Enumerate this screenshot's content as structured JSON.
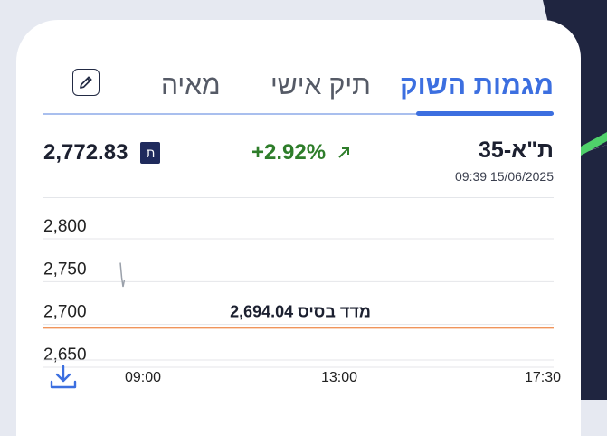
{
  "tabs": {
    "market": "מגמות השוק",
    "personal": "תיק אישי",
    "maya": "מאיה"
  },
  "index": {
    "name": "ת\"א-35",
    "timestamp": "09:39 15/06/2025",
    "change": "+2.92%",
    "value": "2,772.83",
    "currency": "ת"
  },
  "colors": {
    "accent": "#3c6fe0",
    "positive": "#2e7d2a",
    "baseline": "#f0945a"
  },
  "icons": {
    "edit": "pencil-icon",
    "trend": "arrow-up-right-icon",
    "download": "download-icon"
  },
  "chart_data": {
    "type": "line",
    "y_ticks": [
      "2,800",
      "2,750",
      "2,700",
      "2,650"
    ],
    "x_ticks": [
      "09:00",
      "13:00",
      "17:30"
    ],
    "ylim": [
      2630,
      2820
    ],
    "x_range": [
      "09:00",
      "17:30"
    ],
    "baseline": {
      "label": "מדד בסיס 2,694.04",
      "value": 2694.04
    },
    "series": [
      {
        "x": [
          "09:00",
          "09:01",
          "09:02",
          "09:03"
        ],
        "values": [
          2772,
          2755,
          2744,
          2752
        ]
      }
    ],
    "grid": true
  }
}
